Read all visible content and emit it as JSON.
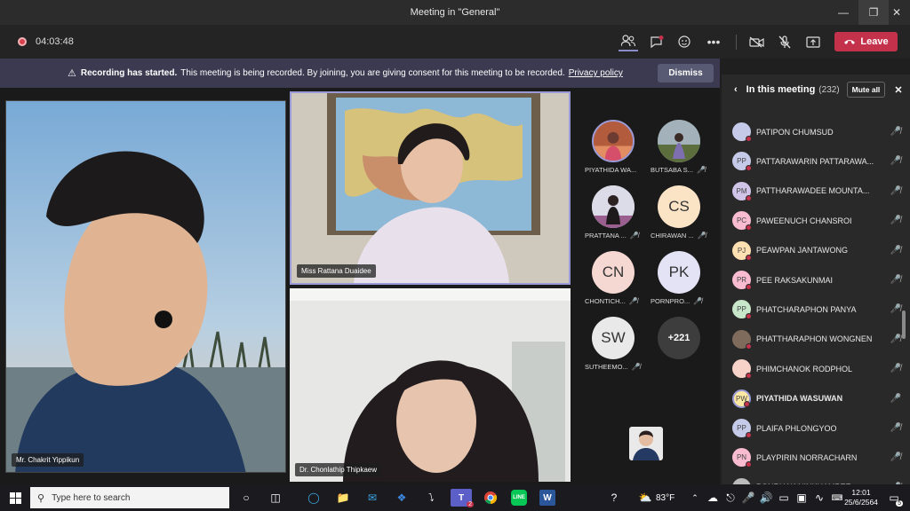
{
  "window": {
    "title": "Meeting in \"General\""
  },
  "toolbar": {
    "timer": "04:03:48",
    "leave_label": "Leave"
  },
  "banner": {
    "bold": "Recording has started.",
    "text": "This meeting is being recorded. By joining, you are giving consent for this meeting to be recorded.",
    "link": "Privacy policy",
    "dismiss": "Dismiss"
  },
  "stage": {
    "tiles": [
      {
        "name": "Mr. Chakrit Yippikun"
      },
      {
        "name": "Miss Rattana Duaidee"
      },
      {
        "name": "Dr. Chonlathip Thipkaew"
      }
    ]
  },
  "gallery": [
    {
      "initials": "",
      "name": "PIYATHIDA WA...",
      "muted": false
    },
    {
      "initials": "",
      "name": "BUTSABA S...",
      "muted": true
    },
    {
      "initials": "",
      "name": "PRATTANA ...",
      "muted": true
    },
    {
      "initials": "CS",
      "name": "CHIRAWAN ...",
      "muted": true
    },
    {
      "initials": "CN",
      "name": "CHONTICH...",
      "muted": true
    },
    {
      "initials": "PK",
      "name": "PORNPRO...",
      "muted": true
    },
    {
      "initials": "SW",
      "name": "SUTHEEMO...",
      "muted": true
    },
    {
      "initials": "+221",
      "name": "",
      "muted": false
    }
  ],
  "panel": {
    "title": "In this meeting",
    "count": "(232)",
    "mute_all": "Mute all",
    "people": [
      {
        "initials": "",
        "name": "PATIPON CHUMSUD",
        "speaking": false
      },
      {
        "initials": "PP",
        "name": "PATTARAWARIN PATTARAWA...",
        "speaking": false
      },
      {
        "initials": "PM",
        "name": "PATTHARAWADEE MOUNTA...",
        "speaking": false
      },
      {
        "initials": "PC",
        "name": "PAWEENUCH CHANSROI",
        "speaking": false
      },
      {
        "initials": "PJ",
        "name": "PEAWPAN JANTAWONG",
        "speaking": false
      },
      {
        "initials": "PR",
        "name": "PEE RAKSAKUNMAI",
        "speaking": false
      },
      {
        "initials": "PP",
        "name": "PHATCHARAPHON PANYA",
        "speaking": false
      },
      {
        "initials": "",
        "name": "PHATTHARAPHON WONGNEN",
        "speaking": false
      },
      {
        "initials": "",
        "name": "PHIMCHANOK RODPHOL",
        "speaking": false
      },
      {
        "initials": "PW",
        "name": "PIYATHIDA WASUWAN",
        "speaking": true
      },
      {
        "initials": "PP",
        "name": "PLAIFA PHLONGYOO",
        "speaking": false
      },
      {
        "initials": "PN",
        "name": "PLAYPIRIN NORRACHARN",
        "speaking": false
      },
      {
        "initials": "",
        "name": "PONRUAK NINKHAMPEE",
        "speaking": false
      }
    ]
  },
  "taskbar": {
    "search_placeholder": "Type here to search",
    "weather": "83°F",
    "time": "12:01",
    "date": "25/6/2564",
    "teams_badge": "2",
    "notif_count": "5"
  }
}
